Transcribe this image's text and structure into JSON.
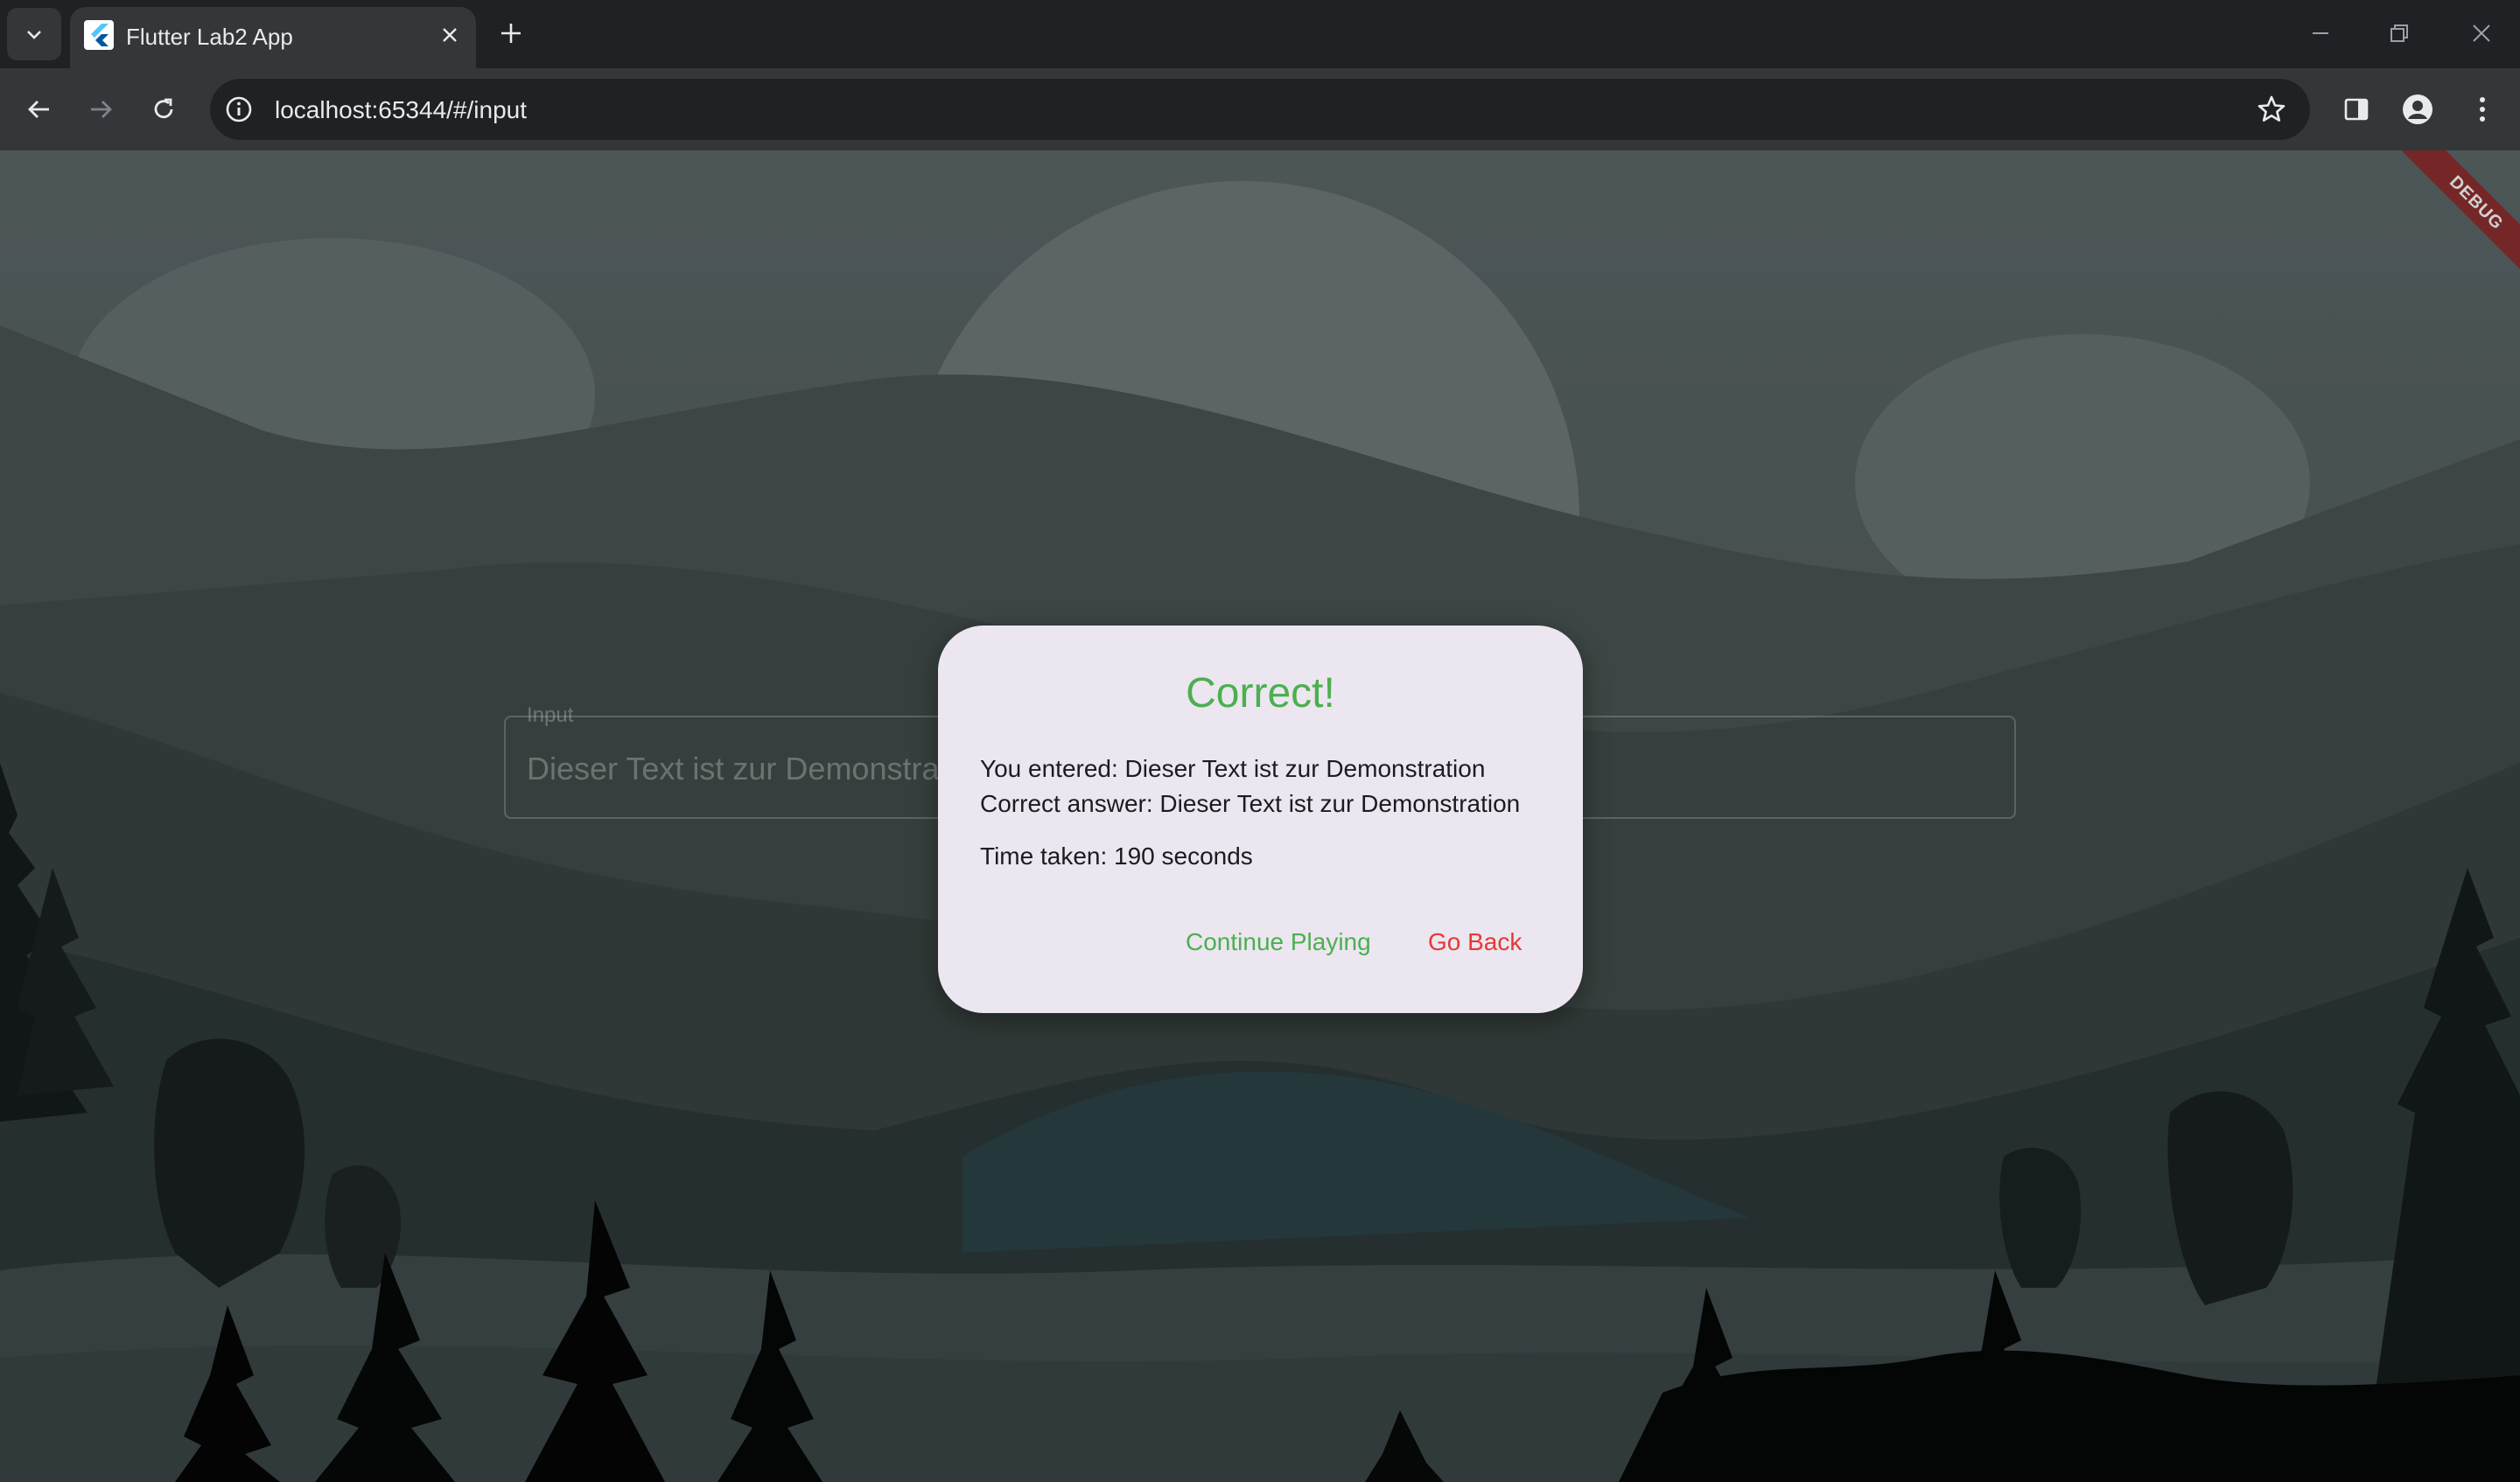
{
  "browser": {
    "tab_title": "Flutter Lab2 App",
    "url": "localhost:65344/#/input"
  },
  "app": {
    "debug_banner": "DEBUG",
    "input": {
      "label": "Input",
      "value": "Dieser Text ist zur Demonstration"
    },
    "dialog": {
      "title": "Correct!",
      "entered_line": "You entered: Dieser Text ist zur Demonstration",
      "answer_line": "Correct answer: Dieser Text ist zur Demonstration",
      "time_line": "Time taken: 190 seconds",
      "continue_label": "Continue Playing",
      "back_label": "Go Back"
    }
  },
  "colors": {
    "success": "#4caf50",
    "danger": "#e53935",
    "dialog_bg": "#ece6f0"
  }
}
